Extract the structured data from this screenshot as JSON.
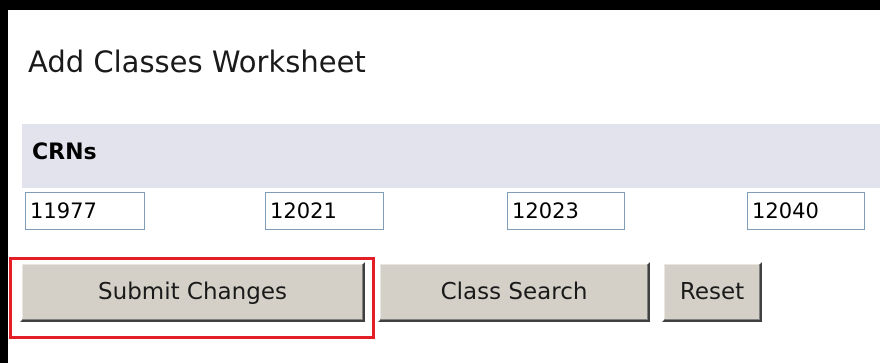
{
  "form": {
    "title": "Add Classes Worksheet",
    "crn_header": "CRNs",
    "crn_values": [
      "11977",
      "12021",
      "12023",
      "12040"
    ]
  },
  "buttons": {
    "submit_label": "Submit Changes",
    "class_search_label": "Class Search",
    "reset_label": "Reset"
  },
  "colors": {
    "header_band": "#e3e3ee",
    "button_face": "#d4d0c8",
    "highlight": "#e41e26",
    "frame": "#000000"
  }
}
